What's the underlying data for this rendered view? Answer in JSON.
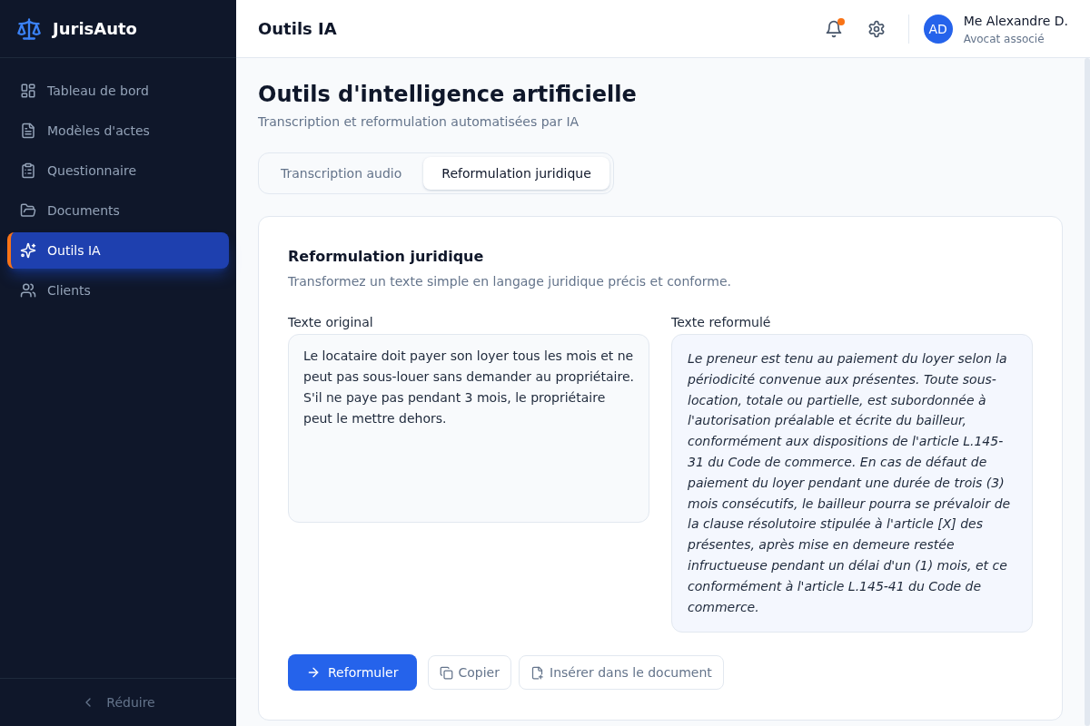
{
  "sidebar": {
    "brand": "JurisAuto",
    "items": [
      {
        "label": "Tableau de bord",
        "selected": false
      },
      {
        "label": "Modèles d'actes",
        "selected": false
      },
      {
        "label": "Questionnaire",
        "selected": false
      },
      {
        "label": "Documents",
        "selected": false
      },
      {
        "label": "Outils IA",
        "selected": true
      },
      {
        "label": "Clients",
        "selected": false
      }
    ],
    "collapse": "Réduire"
  },
  "header": {
    "title": "Outils IA",
    "notifications": {
      "unread": true
    },
    "user": {
      "initials": "AD",
      "name": "Me Alexandre D.",
      "role": "Avocat associé"
    }
  },
  "page": {
    "title": "Outils d'intelligence artificielle",
    "subtitle": "Transcription et reformulation automatisées par IA"
  },
  "tabs": [
    {
      "label": "Transcription audio",
      "selected": false
    },
    {
      "label": "Reformulation juridique",
      "selected": true
    }
  ],
  "panel": {
    "title": "Reformulation juridique",
    "description": "Transformez un texte simple en langage juridique précis et conforme.",
    "original": {
      "label": "Texte original",
      "value": "Le locataire doit payer son loyer tous les mois et ne peut pas sous-louer sans demander au propriétaire. S'il ne paye pas pendant 3 mois, le propriétaire peut le mettre dehors."
    },
    "reformulated": {
      "label": "Texte reformulé",
      "text": "Le preneur est tenu au paiement du loyer selon la périodicité convenue aux présentes. Toute sous-location, totale ou partielle, est subordonnée à l'autorisation préalable et écrite du bailleur, conformément aux dispositions de l'article L.145-31 du Code de commerce. En cas de défaut de paiement du loyer pendant une durée de trois (3) mois consécutifs, le bailleur pourra se prévaloir de la clause résolutoire stipulée à l'article [X] des présentes, après mise en demeure restée infructueuse pendant un délai d'un (1) mois, et ce conformément à l'article L.145-41 du Code de commerce."
    },
    "buttons": [
      {
        "label": "Reformuler",
        "kind": "primary"
      },
      {
        "label": "Copier",
        "kind": "secondary"
      },
      {
        "label": "Insérer dans le document",
        "kind": "secondary"
      }
    ]
  }
}
